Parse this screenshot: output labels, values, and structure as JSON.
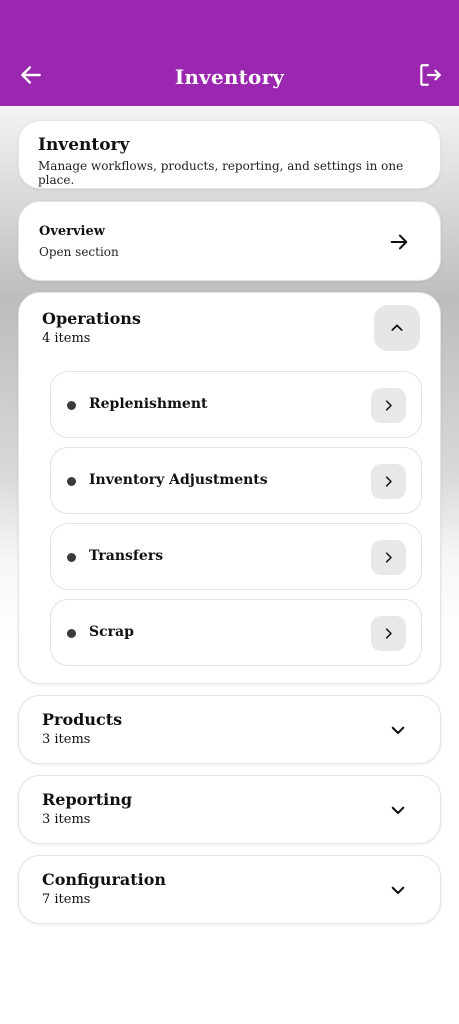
{
  "header": {
    "title": "Inventory",
    "background_color": "#9b27b0",
    "back_icon": "arrow-left-icon",
    "logout_icon": "logout-icon"
  },
  "intro": {
    "title": "Inventory",
    "description": "Manage workflows, products, reporting, and settings in one place."
  },
  "overview": {
    "title": "Overview",
    "subtitle": "Open section",
    "icon": "arrow-right-icon"
  },
  "sections": [
    {
      "title": "Operations",
      "count": "4 items",
      "expanded": true,
      "items": [
        {
          "label": "Replenishment"
        },
        {
          "label": "Inventory Adjustments"
        },
        {
          "label": "Transfers"
        },
        {
          "label": "Scrap"
        }
      ]
    },
    {
      "title": "Products",
      "count": "3 items",
      "expanded": false
    },
    {
      "title": "Reporting",
      "count": "3 items",
      "expanded": false
    },
    {
      "title": "Configuration",
      "count": "7 items",
      "expanded": false
    }
  ]
}
